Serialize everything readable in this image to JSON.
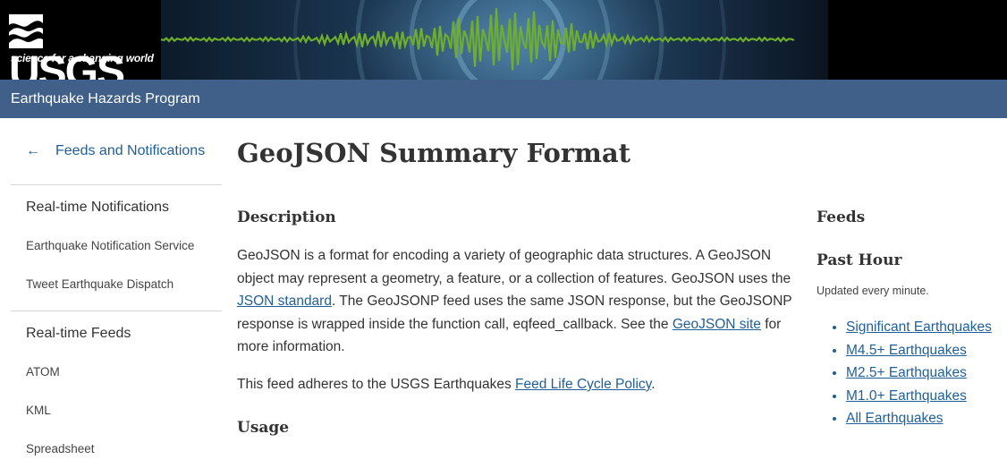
{
  "header": {
    "logo_text": "USGS",
    "logo_tagline": "science for a changing world",
    "program": "Earthquake Hazards Program"
  },
  "sidebar": {
    "back_label": "Feeds and Notifications",
    "sections": [
      {
        "title": "Real-time Notifications",
        "items": [
          "Earthquake Notification Service",
          "Tweet Earthquake Dispatch"
        ]
      },
      {
        "title": "Real-time Feeds",
        "items": [
          "ATOM",
          "KML",
          "Spreadsheet"
        ]
      }
    ]
  },
  "main": {
    "title": "GeoJSON Summary Format",
    "description_heading": "Description",
    "description": {
      "p1_a": "GeoJSON is a format for encoding a variety of geographic data structures. A GeoJSON object may represent a geometry, a feature, or a collection of features. GeoJSON uses the ",
      "p1_link1": "JSON standard",
      "p1_b": ". The GeoJSONP feed uses the same JSON response, but the GeoJSONP response is wrapped inside the function call, eqfeed_callback. See the ",
      "p1_link2": "GeoJSON site",
      "p1_c": " for more information.",
      "p2_a": "This feed adheres to the USGS Earthquakes ",
      "p2_link": "Feed Life Cycle Policy",
      "p2_b": "."
    },
    "usage_heading": "Usage"
  },
  "aside": {
    "feeds_heading": "Feeds",
    "past_hour_heading": "Past Hour",
    "updated": "Updated every minute.",
    "links": [
      "Significant Earthquakes",
      "M4.5+ Earthquakes",
      "M2.5+ Earthquakes",
      "M1.0+ Earthquakes",
      "All Earthquakes"
    ]
  },
  "colors": {
    "program_bar": "#40608a",
    "link": "#1f5f99",
    "seismograph": "#6fae2a"
  },
  "icons": {
    "back": "left-arrow-icon",
    "logo": "usgs-waves-icon"
  }
}
